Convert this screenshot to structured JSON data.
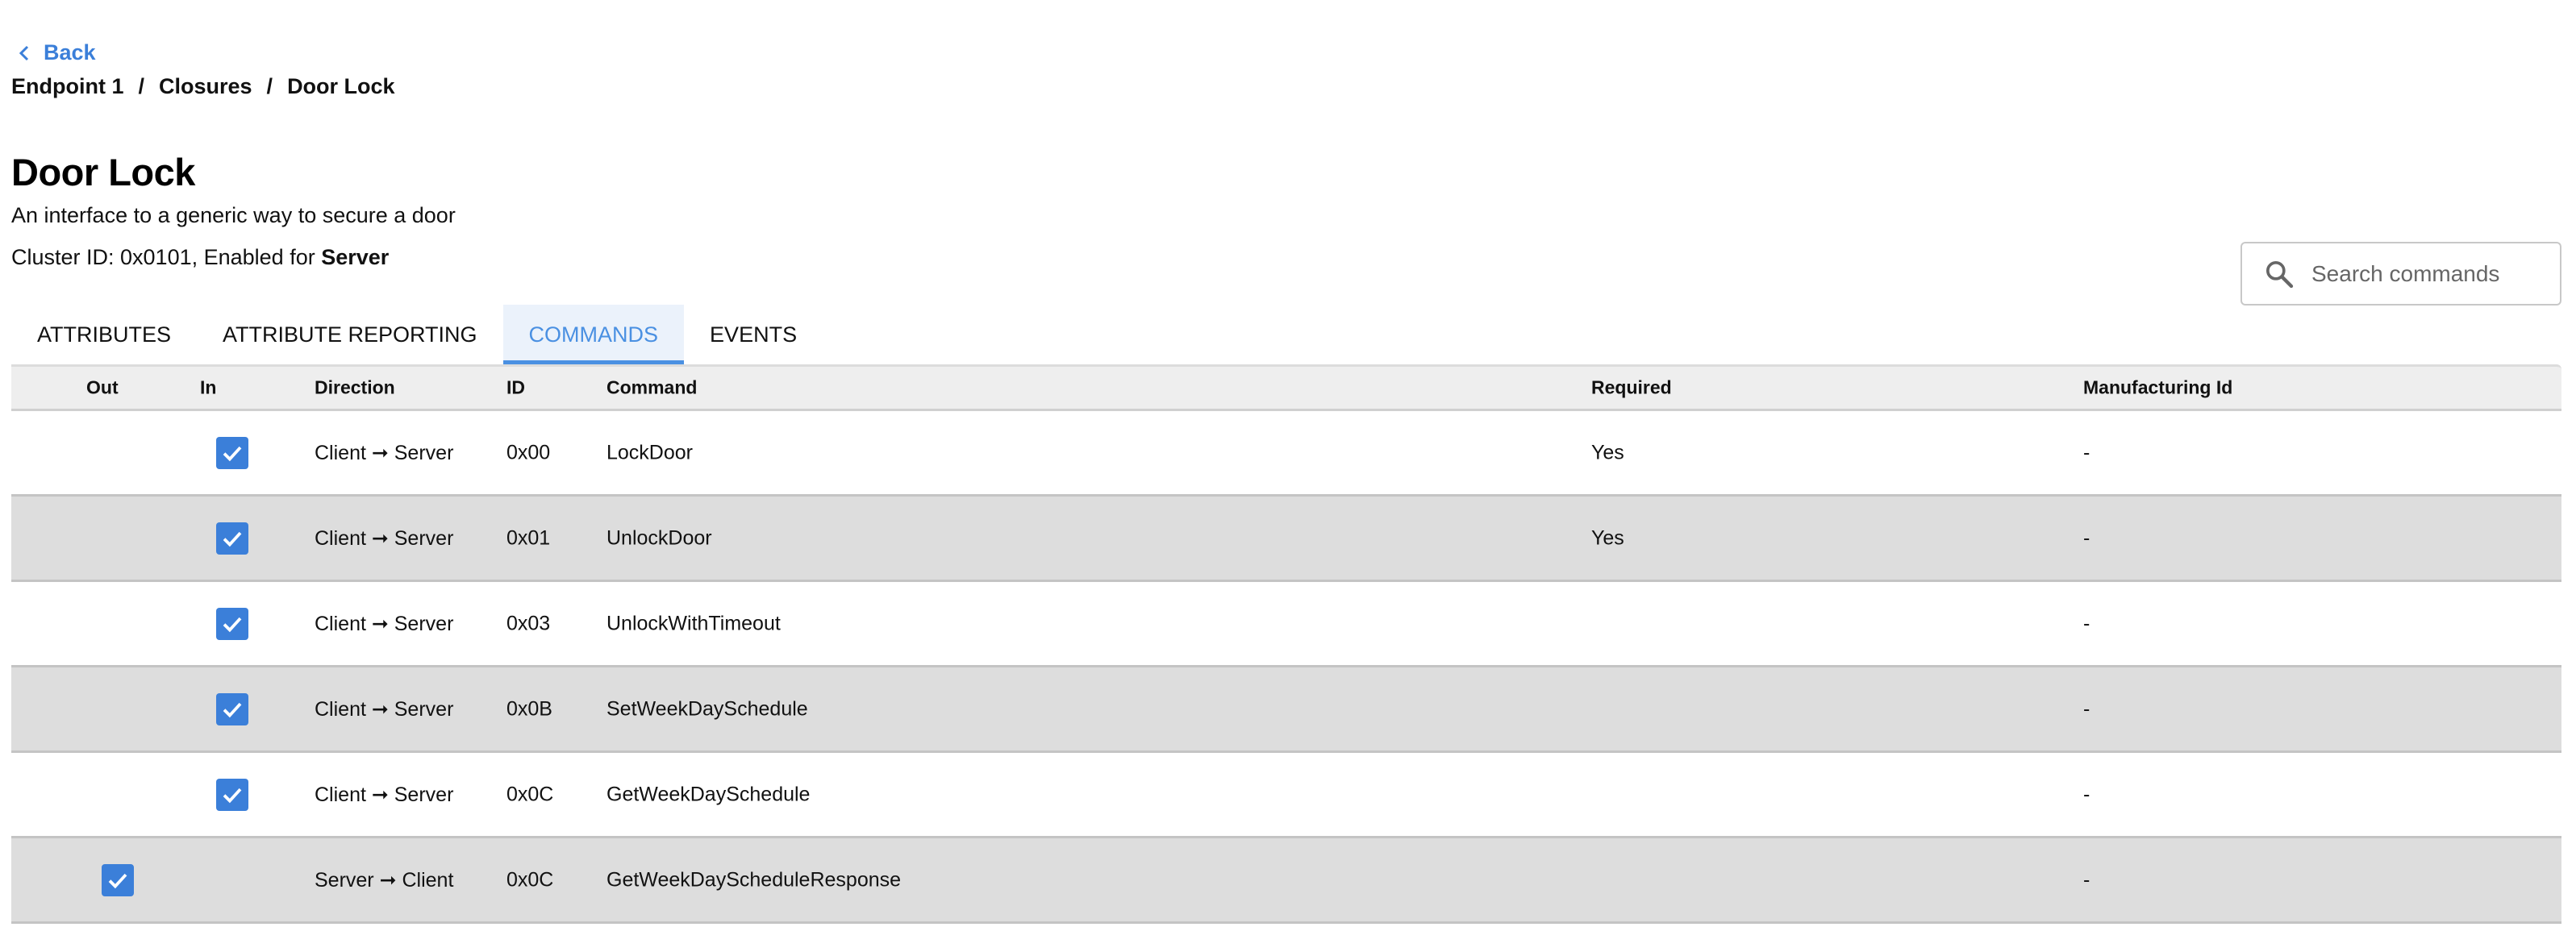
{
  "nav": {
    "back_label": "Back",
    "breadcrumb": [
      "Endpoint 1",
      "Closures",
      "Door Lock"
    ],
    "breadcrumb_separator": "/"
  },
  "header": {
    "title": "Door Lock",
    "description": "An interface to a generic way to secure a door",
    "cluster_prefix": "Cluster ID: 0x0101, Enabled for ",
    "cluster_side": "Server"
  },
  "search": {
    "placeholder": "Search commands",
    "value": ""
  },
  "tabs": [
    {
      "label": "ATTRIBUTES",
      "active": false
    },
    {
      "label": "ATTRIBUTE REPORTING",
      "active": false
    },
    {
      "label": "COMMANDS",
      "active": true
    },
    {
      "label": "EVENTS",
      "active": false
    }
  ],
  "table": {
    "columns": [
      "Out",
      "In",
      "Direction",
      "ID",
      "Command",
      "Required",
      "Manufacturing Id"
    ],
    "rows": [
      {
        "out": false,
        "in": true,
        "direction": "Client ➞ Server",
        "id": "0x00",
        "command": "LockDoor",
        "required": "Yes",
        "mfg_id": "-"
      },
      {
        "out": false,
        "in": true,
        "direction": "Client ➞ Server",
        "id": "0x01",
        "command": "UnlockDoor",
        "required": "Yes",
        "mfg_id": "-"
      },
      {
        "out": false,
        "in": true,
        "direction": "Client ➞ Server",
        "id": "0x03",
        "command": "UnlockWithTimeout",
        "required": "",
        "mfg_id": "-"
      },
      {
        "out": false,
        "in": true,
        "direction": "Client ➞ Server",
        "id": "0x0B",
        "command": "SetWeekDaySchedule",
        "required": "",
        "mfg_id": "-"
      },
      {
        "out": false,
        "in": true,
        "direction": "Client ➞ Server",
        "id": "0x0C",
        "command": "GetWeekDaySchedule",
        "required": "",
        "mfg_id": "-"
      },
      {
        "out": true,
        "in": false,
        "direction": "Server ➞ Client",
        "id": "0x0C",
        "command": "GetWeekDayScheduleResponse",
        "required": "",
        "mfg_id": "-"
      }
    ]
  },
  "colors": {
    "accent": "#3b7fd9",
    "tab_active_text": "#4a90e2",
    "tab_active_bg": "#ebf2fb",
    "row_alt_bg": "#dddddd",
    "header_bg": "#eeeeee"
  }
}
